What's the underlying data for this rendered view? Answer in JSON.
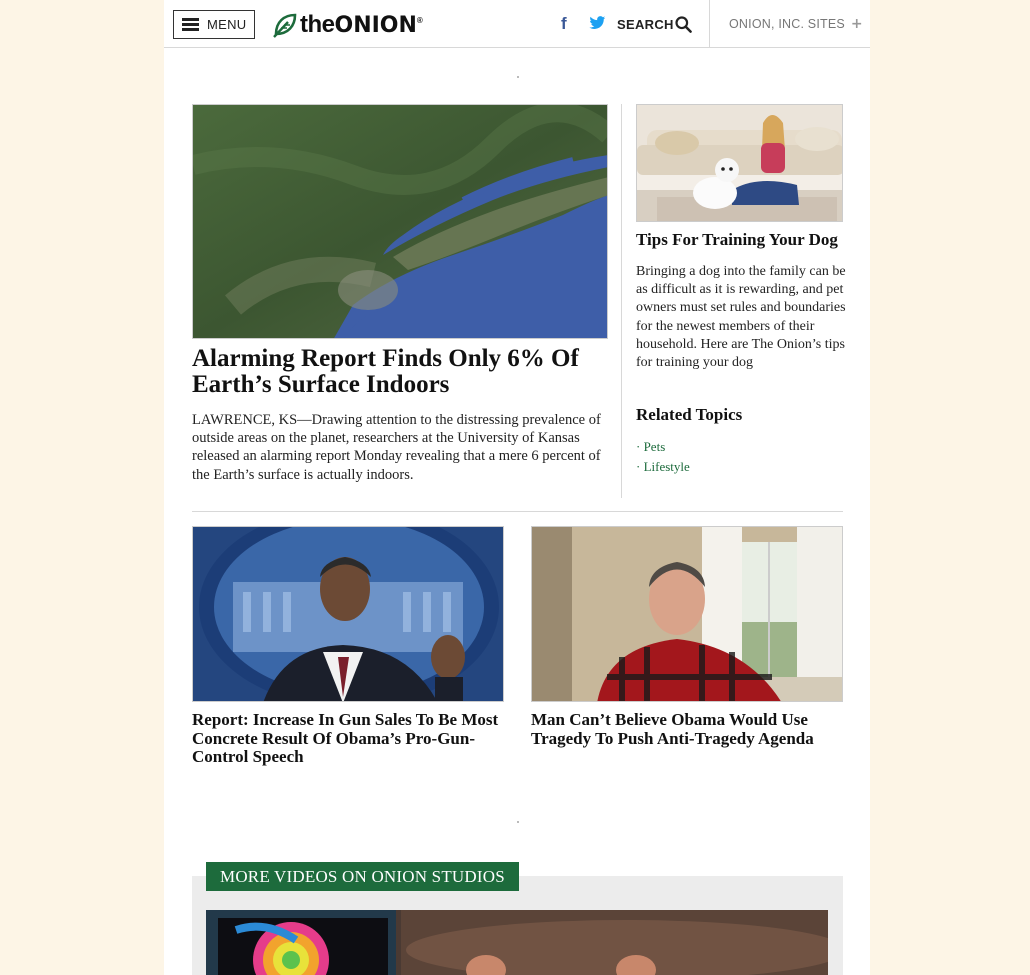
{
  "header": {
    "menu_label": "MENU",
    "logo": {
      "the": "the",
      "onion": "ONION",
      "reg": "®"
    },
    "facebook_glyph": "f",
    "search_label": "SEARCH",
    "sites_label": "ONION, INC. SITES",
    "sites_plus": "+"
  },
  "colors": {
    "brand_green": "#1d6b3c",
    "facebook_blue": "#3b5998",
    "twitter_blue": "#1da1f2",
    "background": "#fdf5e6"
  },
  "icons": [
    "hamburger-icon",
    "onion-leaf-icon",
    "facebook-icon",
    "twitter-icon",
    "search-icon",
    "plus-icon"
  ],
  "hero": {
    "title": "Alarming Report Finds Only 6% Of Earth’s Surface Indoors",
    "dek": "LAWRENCE, KS—Drawing attention to the distressing prevalence of outside areas on the planet, researchers at the University of Kansas released an alarming report Monday revealing that a mere 6 percent of the Earth’s surface is actually indoors."
  },
  "side": {
    "title": "Tips For Training Your Dog",
    "body": "Bringing a dog into the family can be as difficult as it is rewarding, and pet owners must set rules and boundaries for the newest members of their household. Here are The Onion’s tips for training your dog",
    "related_heading": "Related Topics",
    "topics": [
      "· Pets",
      "· Lifestyle"
    ]
  },
  "cards": [
    {
      "title": "Report: Increase In Gun Sales To Be Most Concrete Result Of Obama’s Pro-Gun-Control Speech"
    },
    {
      "title": "Man Can’t Believe Obama Would Use Tragedy To Push Anti-Tragedy Agenda"
    }
  ],
  "videos": {
    "banner": "MORE VIDEOS ON ONION STUDIOS"
  }
}
